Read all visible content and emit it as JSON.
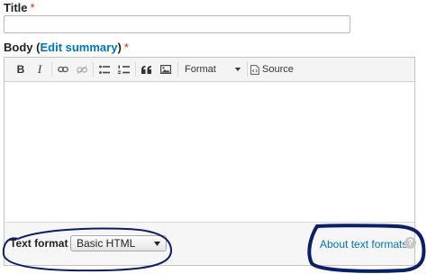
{
  "title_field": {
    "label": "Title",
    "required_mark": "*",
    "value": ""
  },
  "body_field": {
    "label": "Body",
    "open_paren": "(",
    "edit_summary_link": "Edit summary",
    "close_paren": ")",
    "required_mark": "*"
  },
  "toolbar": {
    "bold": "B",
    "italic": "I",
    "format_label": "Format",
    "source_label": "Source"
  },
  "editor": {
    "content": ""
  },
  "text_format": {
    "label": "Text format",
    "selected": "Basic HTML",
    "about_link": "About text formats",
    "help_glyph": "?"
  },
  "colors": {
    "required": "#e32700",
    "link": "#0074bd",
    "annotation": "#0b1f66"
  },
  "icons": [
    "link-icon",
    "unlink-icon",
    "bulleted-list-icon",
    "numbered-list-icon",
    "blockquote-icon",
    "image-icon",
    "chevron-down-icon",
    "source-icon",
    "help-icon"
  ]
}
